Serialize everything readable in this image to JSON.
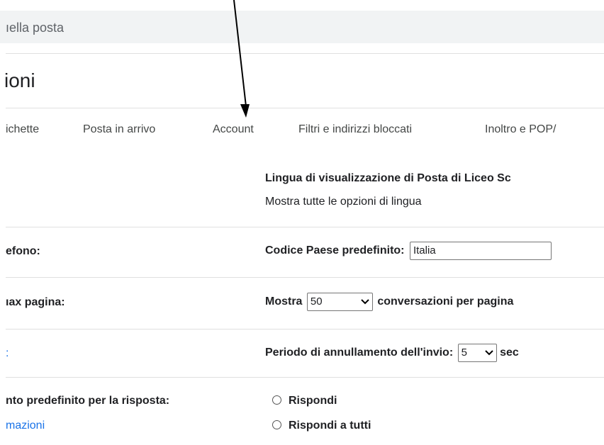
{
  "search": {
    "placeholder_fragment": "ıella posta"
  },
  "page": {
    "title_fragment": "ioni"
  },
  "tabs": [
    {
      "label": "ichette"
    },
    {
      "label": "Posta in arrivo"
    },
    {
      "label": "Account"
    },
    {
      "label": "Filtri e indirizzi bloccati"
    },
    {
      "label": "Inoltro e POP/"
    }
  ],
  "rows": {
    "language": {
      "heading": "Lingua di visualizzazione di Posta di Liceo Sc",
      "link": "Mostra tutte le opzioni di lingua"
    },
    "phone": {
      "label": "efono:",
      "setting_label": "Codice Paese predefinito:",
      "value": "Italia"
    },
    "page_size": {
      "label": "ıax pagina:",
      "prefix": "Mostra",
      "value": "50",
      "suffix": "conversazioni per pagina"
    },
    "undo_send": {
      "label": ":",
      "setting_label": "Periodo di annullamento dell'invio:",
      "value": "5",
      "suffix": "sec"
    },
    "reply": {
      "label": "nto predefinito per la risposta:",
      "link": "mazioni",
      "options": [
        "Rispondi",
        "Rispondi a tutti"
      ]
    }
  },
  "colors": {
    "link": "#1a73e8",
    "search_bg": "#f1f3f4",
    "divider": "#e0e0e0"
  },
  "icons": [
    "chevron-down-icon",
    "radio-unchecked-icon",
    "annotation-arrow"
  ]
}
